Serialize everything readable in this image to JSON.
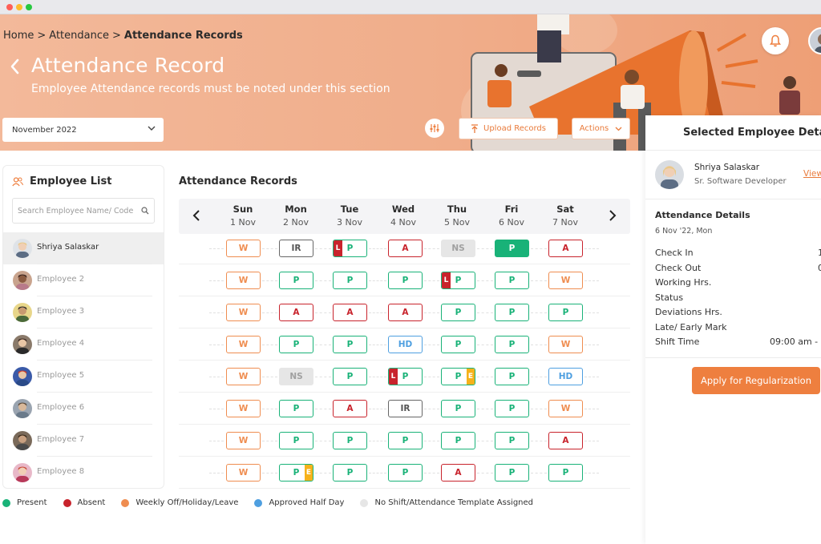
{
  "breadcrumb": {
    "home": "Home",
    "attendance": "Attendance",
    "current": "Attendance Records",
    "separator": ">"
  },
  "header": {
    "title": "Attendance Record",
    "subtitle": "Employee Attendance records must be noted under this section"
  },
  "toolbar": {
    "month": "November 2022",
    "upload_label": "Upload Records",
    "actions_label": "Actions"
  },
  "employee_list": {
    "title": "Employee List",
    "search_placeholder": "Search Employee Name/ Code",
    "employees": [
      {
        "name": "Shriya Salaskar",
        "active": true
      },
      {
        "name": "Employee 2"
      },
      {
        "name": "Employee 3"
      },
      {
        "name": "Employee 4"
      },
      {
        "name": "Employee 5"
      },
      {
        "name": "Employee 6"
      },
      {
        "name": "Employee 7"
      },
      {
        "name": "Employee 8"
      }
    ]
  },
  "attendance": {
    "title": "Attendance Records",
    "days": [
      {
        "name": "Sun",
        "date": "1 Nov"
      },
      {
        "name": "Mon",
        "date": "2 Nov"
      },
      {
        "name": "Tue",
        "date": "3 Nov"
      },
      {
        "name": "Wed",
        "date": "4 Nov"
      },
      {
        "name": "Thu",
        "date": "5 Nov"
      },
      {
        "name": "Fri",
        "date": "6 Nov"
      },
      {
        "name": "Sat",
        "date": "7 Nov"
      }
    ],
    "rows": [
      [
        {
          "code": "W",
          "style": "orange"
        },
        {
          "code": "IR",
          "style": "grey"
        },
        {
          "code": "P",
          "style": "green",
          "flag": "L"
        },
        {
          "code": "A",
          "style": "red"
        },
        {
          "code": "NS",
          "style": "ns"
        },
        {
          "code": "P",
          "style": "solid-green"
        },
        {
          "code": "A",
          "style": "red"
        }
      ],
      [
        {
          "code": "W",
          "style": "orange"
        },
        {
          "code": "P",
          "style": "green"
        },
        {
          "code": "P",
          "style": "green"
        },
        {
          "code": "P",
          "style": "green"
        },
        {
          "code": "P",
          "style": "green",
          "flag": "L"
        },
        {
          "code": "P",
          "style": "green"
        },
        {
          "code": "W",
          "style": "orange"
        }
      ],
      [
        {
          "code": "W",
          "style": "orange"
        },
        {
          "code": "A",
          "style": "red"
        },
        {
          "code": "A",
          "style": "red"
        },
        {
          "code": "A",
          "style": "red"
        },
        {
          "code": "P",
          "style": "green"
        },
        {
          "code": "P",
          "style": "green"
        },
        {
          "code": "P",
          "style": "green"
        }
      ],
      [
        {
          "code": "W",
          "style": "orange"
        },
        {
          "code": "P",
          "style": "green"
        },
        {
          "code": "P",
          "style": "green"
        },
        {
          "code": "HD",
          "style": "blue"
        },
        {
          "code": "P",
          "style": "green"
        },
        {
          "code": "P",
          "style": "green"
        },
        {
          "code": "W",
          "style": "orange"
        }
      ],
      [
        {
          "code": "W",
          "style": "orange"
        },
        {
          "code": "NS",
          "style": "ns"
        },
        {
          "code": "P",
          "style": "green"
        },
        {
          "code": "P",
          "style": "green",
          "flag": "L"
        },
        {
          "code": "P",
          "style": "green",
          "flag": "E"
        },
        {
          "code": "P",
          "style": "green"
        },
        {
          "code": "HD",
          "style": "blue"
        }
      ],
      [
        {
          "code": "W",
          "style": "orange"
        },
        {
          "code": "P",
          "style": "green"
        },
        {
          "code": "A",
          "style": "red"
        },
        {
          "code": "IR",
          "style": "grey"
        },
        {
          "code": "P",
          "style": "green"
        },
        {
          "code": "P",
          "style": "green"
        },
        {
          "code": "W",
          "style": "orange"
        }
      ],
      [
        {
          "code": "W",
          "style": "orange"
        },
        {
          "code": "P",
          "style": "green"
        },
        {
          "code": "P",
          "style": "green"
        },
        {
          "code": "P",
          "style": "green"
        },
        {
          "code": "P",
          "style": "green"
        },
        {
          "code": "P",
          "style": "green"
        },
        {
          "code": "A",
          "style": "red"
        }
      ],
      [
        {
          "code": "W",
          "style": "orange"
        },
        {
          "code": "P",
          "style": "green",
          "flag": "E"
        },
        {
          "code": "P",
          "style": "green"
        },
        {
          "code": "P",
          "style": "green"
        },
        {
          "code": "A",
          "style": "red"
        },
        {
          "code": "P",
          "style": "green"
        },
        {
          "code": "P",
          "style": "green"
        }
      ]
    ]
  },
  "legend": [
    {
      "label": "Present",
      "color": "#19b278"
    },
    {
      "label": "Absent",
      "color": "#c8232c"
    },
    {
      "label": "Weekly Off/Holiday/Leave",
      "color": "#ef8d50"
    },
    {
      "label": "Approved Half Day",
      "color": "#4e9fe0"
    },
    {
      "label": "No Shift/Attendance Template Assigned",
      "color": "#e6e6e6"
    }
  ],
  "detail": {
    "title": "Selected Employee Details",
    "name": "Shriya Salaskar",
    "role": "Sr. Software Developer",
    "view_label": "View",
    "attendance_title": "Attendance Details",
    "date": "6 Nov '22, Mon",
    "fields": [
      {
        "label": "Check In",
        "value": "1"
      },
      {
        "label": "Check Out",
        "value": "0"
      },
      {
        "label": "Working Hrs.",
        "value": ""
      },
      {
        "label": "Status",
        "value": ""
      },
      {
        "label": "Deviations Hrs.",
        "value": ""
      },
      {
        "label": "Late/ Early Mark",
        "value": ""
      },
      {
        "label": "Shift Time",
        "value": "09:00 am -"
      }
    ],
    "regularize_label": "Apply for Regularization"
  },
  "colors": {
    "accent": "#ee7f3f",
    "banner": "#f0ad8a"
  }
}
